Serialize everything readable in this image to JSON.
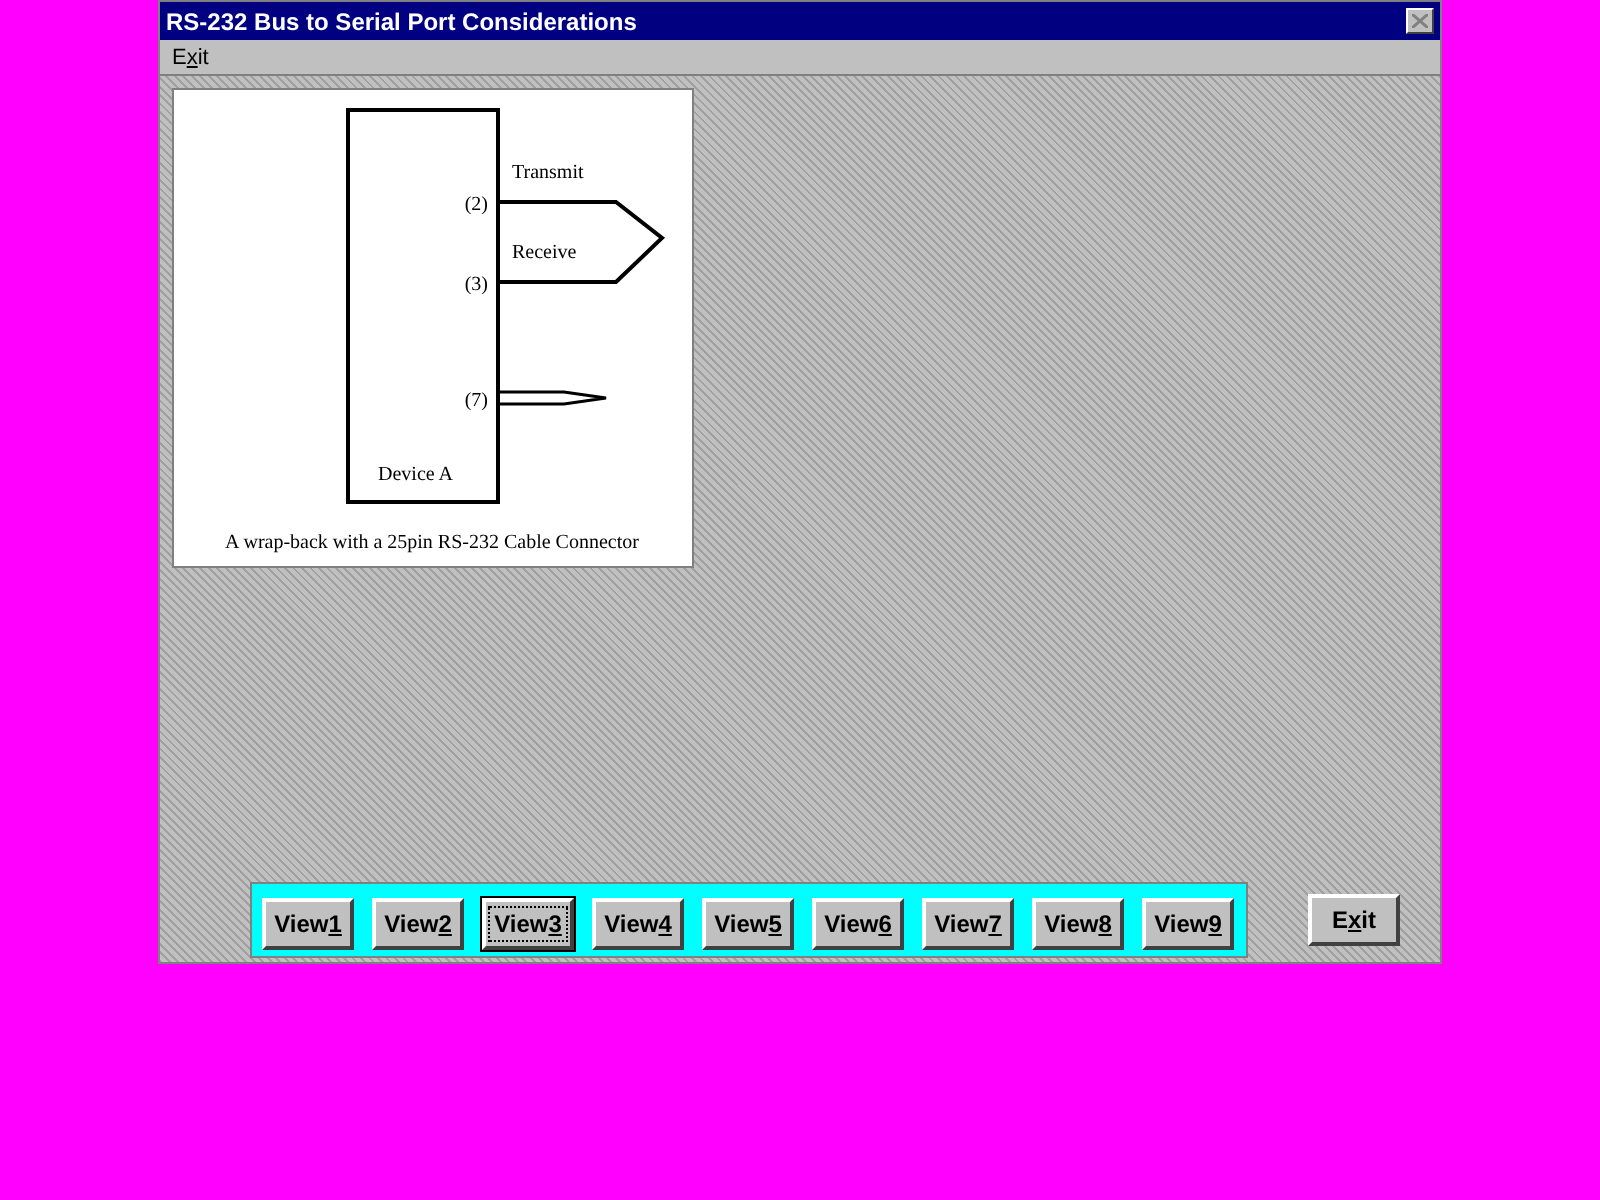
{
  "window": {
    "title": "RS-232 Bus to Serial Port Considerations"
  },
  "menu": [
    {
      "label": "Exit"
    }
  ],
  "diagram": {
    "device": "Device A",
    "pins": [
      {
        "label": "(2)",
        "signal": "Transmit"
      },
      {
        "label": "(3)",
        "signal": "Receive"
      },
      {
        "label": "(7)"
      }
    ],
    "caption": "A wrap-back with a 25pin RS-232 Cable Connector"
  },
  "view_buttons": [
    {
      "label": "View1",
      "selected": false
    },
    {
      "label": "View2",
      "selected": false
    },
    {
      "label": "View3",
      "selected": true
    },
    {
      "label": "View4",
      "selected": false
    },
    {
      "label": "View5",
      "selected": false
    },
    {
      "label": "View6",
      "selected": false
    },
    {
      "label": "View7",
      "selected": false
    },
    {
      "label": "View8",
      "selected": false
    },
    {
      "label": "View9",
      "selected": false
    }
  ],
  "exit_button": {
    "label": "Exit"
  }
}
